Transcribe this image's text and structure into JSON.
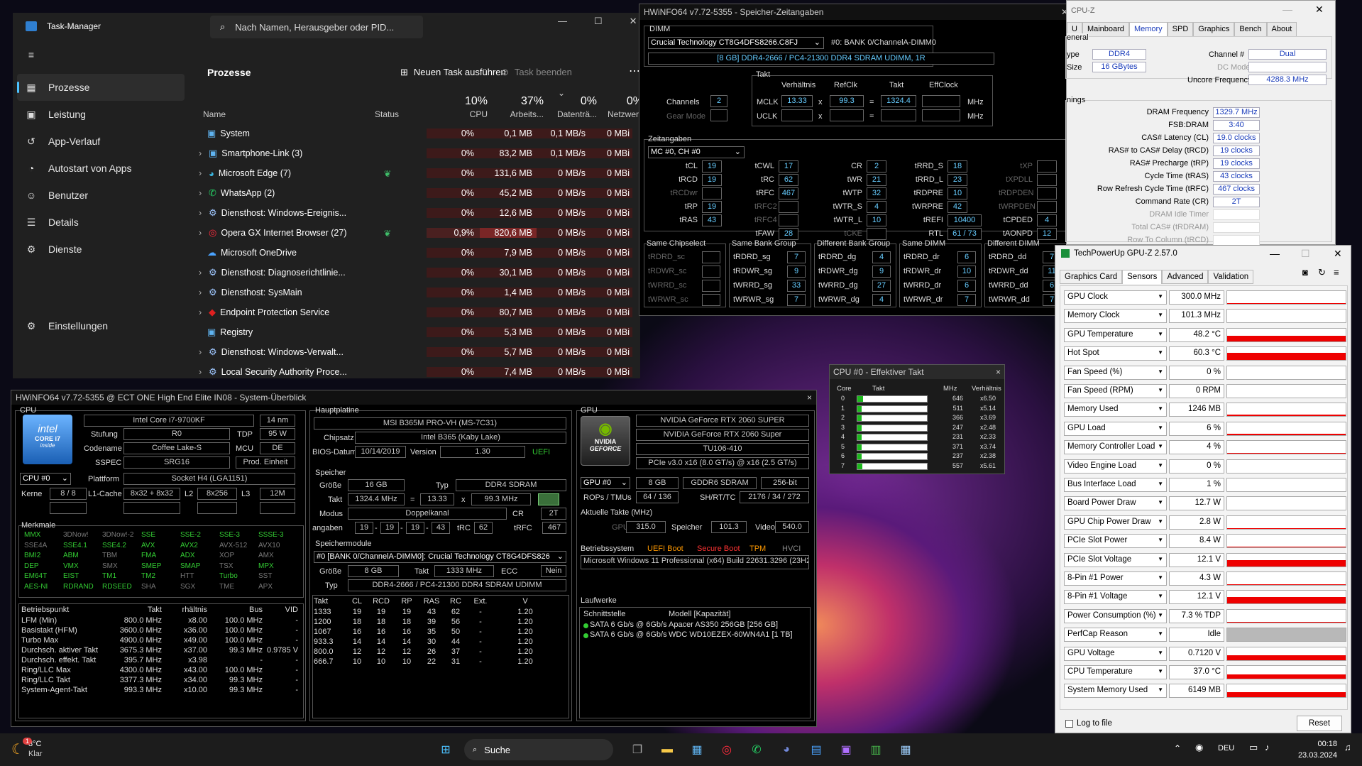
{
  "taskmanager": {
    "title": "Task-Manager",
    "search_placeholder": "Nach Namen, Herausgeber oder PID...",
    "nav": [
      {
        "label": "Prozesse",
        "icon": "grid-icon"
      },
      {
        "label": "Leistung",
        "icon": "chart-icon"
      },
      {
        "label": "App-Verlauf",
        "icon": "history-icon"
      },
      {
        "label": "Autostart von Apps",
        "icon": "speedometer-icon"
      },
      {
        "label": "Benutzer",
        "icon": "users-icon"
      },
      {
        "label": "Details",
        "icon": "list-icon"
      },
      {
        "label": "Dienste",
        "icon": "puzzle-icon"
      }
    ],
    "settings": "Einstellungen",
    "page_title": "Prozesse",
    "new_task": "Neuen Task ausführen",
    "end_task": "Task beenden",
    "col_name": "Name",
    "col_status": "Status",
    "cpu_pct": "10%",
    "cpu_lbl": "CPU",
    "mem_pct": "37%",
    "mem_lbl": "Arbeits...",
    "disk_pct": "0%",
    "disk_lbl": "Datenträ...",
    "net_pct": "0%",
    "net_lbl": "Netzwerk",
    "rows": [
      {
        "name": "System",
        "cpu": "0%",
        "mem": "0,1 MB",
        "disk": "0,1 MB/s",
        "net": "0 MBi"
      },
      {
        "name": "Smartphone-Link (3)",
        "cpu": "0%",
        "mem": "83,2 MB",
        "disk": "0,1 MB/s",
        "net": "0 MBi"
      },
      {
        "name": "Microsoft Edge (7)",
        "cpu": "0%",
        "mem": "131,6 MB",
        "disk": "0 MB/s",
        "net": "0 MBi"
      },
      {
        "name": "WhatsApp (2)",
        "cpu": "0%",
        "mem": "45,2 MB",
        "disk": "0 MB/s",
        "net": "0 MBi"
      },
      {
        "name": "Diensthost: Windows-Ereignis...",
        "cpu": "0%",
        "mem": "12,6 MB",
        "disk": "0 MB/s",
        "net": "0 MBi"
      },
      {
        "name": "Opera GX Internet Browser (27)",
        "cpu": "0,9%",
        "mem": "820,6 MB",
        "disk": "0 MB/s",
        "net": "0 MBi"
      },
      {
        "name": "Microsoft OneDrive",
        "cpu": "0%",
        "mem": "7,9 MB",
        "disk": "0 MB/s",
        "net": "0 MBi"
      },
      {
        "name": "Diensthost: Diagnoserichtlinie...",
        "cpu": "0%",
        "mem": "30,1 MB",
        "disk": "0 MB/s",
        "net": "0 MBi"
      },
      {
        "name": "Diensthost: SysMain",
        "cpu": "0%",
        "mem": "1,4 MB",
        "disk": "0 MB/s",
        "net": "0 MBi"
      },
      {
        "name": "Endpoint Protection Service",
        "cpu": "0%",
        "mem": "80,7 MB",
        "disk": "0 MB/s",
        "net": "0 MBi"
      },
      {
        "name": "Registry",
        "cpu": "0%",
        "mem": "5,3 MB",
        "disk": "0 MB/s",
        "net": "0 MBi"
      },
      {
        "name": "Diensthost: Windows-Verwalt...",
        "cpu": "0%",
        "mem": "5,7 MB",
        "disk": "0 MB/s",
        "net": "0 MBi"
      },
      {
        "name": "Local Security Authority Proce...",
        "cpu": "0%",
        "mem": "7,4 MB",
        "disk": "0 MB/s",
        "net": "0 MBi"
      }
    ]
  },
  "timings": {
    "title": "HWiNFO64 v7.72-5355 - Speicher-Zeitangaben",
    "dimm_lbl": "DIMM",
    "dimm_sel": "Crucial Technology CT8G4DFS8266.C8FJ",
    "dimm_slot": "#0: BANK 0/ChannelA-DIMM0",
    "dimm_info": "[8 GB] DDR4-2666 / PC4-21300 DDR4 SDRAM UDIMM, 1R",
    "takt_lbl": "Takt",
    "verh_lbl": "Verhältnis",
    "refclk_lbl": "RefClk",
    "takt2_lbl": "Takt",
    "effclk_lbl": "EffClock",
    "channels_lbl": "Channels",
    "channels": "2",
    "gearmode_lbl": "Gear Mode",
    "mclk_lbl": "MCLK",
    "mclk_ratio": "13.33",
    "mclk_ref": "99.3",
    "mclk_takt": "1324.4",
    "mhz": "MHz",
    "uclk_lbl": "UCLK",
    "zeit_lbl": "Zeitangaben",
    "mc_sel": "MC #0, CH #0",
    "t": {
      "tCL": "19",
      "tRCD": "19",
      "tRP": "19",
      "tRAS": "43",
      "tCWL": "17",
      "tRC": "62",
      "tRFC": "467",
      "tFAW": "28",
      "CR": "2",
      "tWR": "21",
      "tWTP": "32",
      "tWTR_S": "4",
      "tWTR_L": "10",
      "tRRD_S": "18",
      "tRRD_L": "23",
      "tRDPRE": "10",
      "tWRPRE": "42",
      "tREFI": "10400",
      "RTL": "61 / 73",
      "tCPDED": "4",
      "tAONPD": "12"
    },
    "lbls": {
      "tCL": "tCL",
      "tRCD": "tRCD",
      "tRCDwr": "tRCDwr",
      "tRP": "tRP",
      "tRAS": "tRAS",
      "tCWL": "tCWL",
      "tRC": "tRC",
      "tRFC": "tRFC",
      "tRFC2": "tRFC2",
      "tRFC4": "tRFC4",
      "tFAW": "tFAW",
      "CR": "CR",
      "tWR": "tWR",
      "tWTP": "tWTP",
      "tWTR_S": "tWTR_S",
      "tWTR_L": "tWTR_L",
      "tCKE": "tCKE",
      "tRRD_S": "tRRD_S",
      "tRRD_L": "tRRD_L",
      "tRDPRE": "tRDPRE",
      "tWRPRE": "tWRPRE",
      "tREFI": "tREFI",
      "RTL": "RTL",
      "tXP": "tXP",
      "tXPDLL": "tXPDLL",
      "tRDPDEN": "tRDPDEN",
      "tWRPDEN": "tWRPDEN",
      "tCPDED": "tCPDED",
      "tAONPD": "tAONPD"
    },
    "groups": [
      {
        "title": "Same Chipselect",
        "rows": [
          [
            "tRDRD_sc",
            ""
          ],
          [
            "tRDWR_sc",
            ""
          ],
          [
            "tWRRD_sc",
            ""
          ],
          [
            "tWRWR_sc",
            ""
          ]
        ]
      },
      {
        "title": "Same Bank Group",
        "rows": [
          [
            "tRDRD_sg",
            "7"
          ],
          [
            "tRDWR_sg",
            "9"
          ],
          [
            "tWRRD_sg",
            "33"
          ],
          [
            "tWRWR_sg",
            "7"
          ]
        ]
      },
      {
        "title": "Different Bank Group",
        "rows": [
          [
            "tRDRD_dg",
            "4"
          ],
          [
            "tRDWR_dg",
            "9"
          ],
          [
            "tWRRD_dg",
            "27"
          ],
          [
            "tWRWR_dg",
            "4"
          ]
        ]
      },
      {
        "title": "Same DIMM",
        "rows": [
          [
            "tRDRD_dr",
            "6"
          ],
          [
            "tRDWR_dr",
            "10"
          ],
          [
            "tWRRD_dr",
            "6"
          ],
          [
            "tWRWR_dr",
            "7"
          ]
        ]
      },
      {
        "title": "Different DIMM",
        "rows": [
          [
            "tRDRD_dd",
            "7"
          ],
          [
            "tRDWR_dd",
            "11"
          ],
          [
            "tWRRD_dd",
            "6"
          ],
          [
            "tWRWR_dd",
            "7"
          ]
        ]
      }
    ]
  },
  "efftakt": {
    "title": "CPU #0 - Effektiver Takt",
    "h_core": "Core",
    "h_takt": "Takt",
    "h_mhz": "MHz",
    "h_verh": "Verhältnis",
    "rows": [
      {
        "core": "0",
        "mhz": "646",
        "r": "x6.50",
        "fill": 0.08
      },
      {
        "core": "1",
        "mhz": "511",
        "r": "x5.14",
        "fill": 0.06
      },
      {
        "core": "2",
        "mhz": "366",
        "r": "x3.69",
        "fill": 0.05
      },
      {
        "core": "3",
        "mhz": "247",
        "r": "x2.48",
        "fill": 0.04
      },
      {
        "core": "4",
        "mhz": "231",
        "r": "x2.33",
        "fill": 0.04
      },
      {
        "core": "5",
        "mhz": "371",
        "r": "x3.74",
        "fill": 0.05
      },
      {
        "core": "6",
        "mhz": "237",
        "r": "x2.38",
        "fill": 0.04
      },
      {
        "core": "7",
        "mhz": "557",
        "r": "x5.61",
        "fill": 0.07
      }
    ]
  },
  "summary": {
    "title": "HWiNFO64 v7.72-5355 @ ECT  ONE High End Elite IN08 - System-Überblick",
    "cpu_lbl": "CPU",
    "cpu_name": "Intel Core i7-9700KF",
    "cpu_nm": "14 nm",
    "stufung_lbl": "Stufung",
    "stufung": "R0",
    "tdp_lbl": "TDP",
    "tdp": "95 W",
    "codename_lbl": "Codename",
    "codename": "Coffee Lake-S",
    "mcu_lbl": "MCU",
    "mcu": "DE",
    "sspec_lbl": "SSPEC",
    "sspec": "SRG16",
    "prod": "Prod. Einheit",
    "cpu_sel": "CPU #0",
    "plattform_lbl": "Plattform",
    "plattform": "Socket H4 (LGA1151)",
    "kerne_lbl": "Kerne",
    "kerne": "8 / 8",
    "l1_lbl": "L1-Cache",
    "l1": "8x32 + 8x32",
    "l2_lbl": "L2",
    "l2": "8x256",
    "l3_lbl": "L3",
    "l3": "12M",
    "merkmale_lbl": "Merkmale",
    "features": [
      [
        "MMX",
        "g"
      ],
      [
        "3DNow!",
        "d"
      ],
      [
        "3DNow!-2",
        "d"
      ],
      [
        "SSE",
        "g"
      ],
      [
        "SSE-2",
        "g"
      ],
      [
        "SSE-3",
        "g"
      ],
      [
        "SSSE-3",
        "g"
      ],
      [
        "SSE4A",
        "d"
      ],
      [
        "SSE4.1",
        "g"
      ],
      [
        "SSE4.2",
        "g"
      ],
      [
        "AVX",
        "g"
      ],
      [
        "AVX2",
        "g"
      ],
      [
        "AVX-512",
        "d"
      ],
      [
        "AVX10",
        "d"
      ],
      [
        "BMI2",
        "g"
      ],
      [
        "ABM",
        "g"
      ],
      [
        "TBM",
        "d"
      ],
      [
        "FMA",
        "g"
      ],
      [
        "ADX",
        "g"
      ],
      [
        "XOP",
        "d"
      ],
      [
        "AMX",
        "d"
      ],
      [
        "DEP",
        "g"
      ],
      [
        "VMX",
        "g"
      ],
      [
        "SMX",
        "d"
      ],
      [
        "SMEP",
        "g"
      ],
      [
        "SMAP",
        "g"
      ],
      [
        "TSX",
        "d"
      ],
      [
        "MPX",
        "g"
      ],
      [
        "EM64T",
        "g"
      ],
      [
        "EIST",
        "g"
      ],
      [
        "TM1",
        "g"
      ],
      [
        "TM2",
        "g"
      ],
      [
        "HTT",
        "d"
      ],
      [
        "Turbo",
        "g"
      ],
      [
        "SST",
        "d"
      ],
      [
        "AES-NI",
        "g"
      ],
      [
        "RDRAND",
        "g"
      ],
      [
        "RDSEED",
        "g"
      ],
      [
        "SHA",
        "d"
      ],
      [
        "SGX",
        "d"
      ],
      [
        "TME",
        "d"
      ],
      [
        "APX",
        "d"
      ]
    ],
    "bp_headers": [
      "Betriebspunkt",
      "Takt",
      "rhältnis",
      "Bus",
      "VID"
    ],
    "bp_rows": [
      [
        "LFM (Min)",
        "800.0 MHz",
        "x8.00",
        "100.0 MHz",
        "-"
      ],
      [
        "Basistakt (HFM)",
        "3600.0 MHz",
        "x36.00",
        "100.0 MHz",
        "-"
      ],
      [
        "Turbo Max",
        "4900.0 MHz",
        "x49.00",
        "100.0 MHz",
        "-"
      ],
      [
        "Durchsch. aktiver Takt",
        "3675.3 MHz",
        "x37.00",
        "99.3 MHz",
        "0.9785 V"
      ],
      [
        "Durchsch. effekt. Takt",
        "395.7 MHz",
        "x3.98",
        "-",
        "-"
      ],
      [
        "Ring/LLC Max",
        "4300.0 MHz",
        "x43.00",
        "100.0 MHz",
        "-"
      ],
      [
        "Ring/LLC Takt",
        "3377.3 MHz",
        "x34.00",
        "99.3 MHz",
        "-"
      ],
      [
        "System-Agent-Takt",
        "993.3 MHz",
        "x10.00",
        "99.3 MHz",
        "-"
      ]
    ],
    "hp_lbl": "Hauptplatine",
    "mb": "MSI B365M PRO-VH (MS-7C31)",
    "chipsatz_lbl": "Chipsatz",
    "chipsatz": "Intel B365 (Kaby Lake)",
    "bios_lbl": "BIOS-Datum",
    "bios_date": "10/14/2019",
    "version_lbl": "Version",
    "version": "1.30",
    "uefi": "UEFI",
    "sp_lbl": "Speicher",
    "groesse_lbl": "Größe",
    "groesse": "16 GB",
    "typ_lbl": "Typ",
    "typ": "DDR4 SDRAM",
    "takt_lbl": "Takt",
    "takt": "1324.4 MHz",
    "eq": "=",
    "ratio": "13.33",
    "x": "x",
    "bus": "99.3 MHz",
    "modus_lbl": "Modus",
    "modus": "Doppelkanal",
    "cr_lbl": "CR",
    "cr": "2T",
    "zeit_lbl": "angaben",
    "z": [
      "19",
      "19",
      "19",
      "43"
    ],
    "trc_lbl": "tRC",
    "trc": "62",
    "trfc_lbl": "tRFC",
    "trfc": "467",
    "spm_lbl": "Speichermodule",
    "spm_sel": "#0 [BANK 0/ChannelA-DIMM0]: Crucial Technology CT8G4DFS826",
    "spm_size": "8 GB",
    "spm_takt_lbl": "Takt",
    "spm_takt": "1333 MHz",
    "ecc_lbl": "ECC",
    "ecc": "Nein",
    "spm_typ": "DDR4-2666 / PC4-21300 DDR4 SDRAM UDIMM",
    "spm_headers": [
      "Takt",
      "CL",
      "RCD",
      "RP",
      "RAS",
      "RC",
      "Ext.",
      "V"
    ],
    "spm_rows": [
      [
        "1333",
        "19",
        "19",
        "19",
        "43",
        "62",
        "-",
        "1.20"
      ],
      [
        "1200",
        "18",
        "18",
        "18",
        "39",
        "56",
        "-",
        "1.20"
      ],
      [
        "1067",
        "16",
        "16",
        "16",
        "35",
        "50",
        "-",
        "1.20"
      ],
      [
        "933.3",
        "14",
        "14",
        "14",
        "30",
        "44",
        "-",
        "1.20"
      ],
      [
        "800.0",
        "12",
        "12",
        "12",
        "26",
        "37",
        "-",
        "1.20"
      ],
      [
        "666.7",
        "10",
        "10",
        "10",
        "22",
        "31",
        "-",
        "1.20"
      ]
    ],
    "gpu_lbl": "GPU",
    "gpu1": "NVIDIA GeForce RTX 2060 SUPER",
    "gpu2": "NVIDIA GeForce RTX 2060 Super",
    "gpu3": "TU106-410",
    "gpu4": "PCIe v3.0 x16 (8.0 GT/s) @ x16 (2.5 GT/s)",
    "gpu_sel": "GPU #0",
    "vram": "8 GB",
    "vtype": "GDDR6 SDRAM",
    "vbit": "256-bit",
    "rops_lbl": "ROPs / TMUs",
    "rops": "64 / 136",
    "sh_lbl": "SH/RT/TC",
    "sh": "2176 / 34 / 272",
    "akt_lbl": "Aktuelle Takte (MHz)",
    "gpu_clk_lbl": "GPU",
    "gpu_clk": "315.0",
    "mem_clk_lbl": "Speicher",
    "mem_clk": "101.3",
    "vid_clk_lbl": "Video",
    "vid_clk": "540.0",
    "os_lbl": "Betriebssystem",
    "uefi_boot": "UEFI Boot",
    "secure_boot": "Secure Boot",
    "tpm": "TPM",
    "hvci": "HVCI",
    "os": "Microsoft Windows 11 Professional (x64) Build 22631.3296 (23H2)",
    "lw_lbl": "Laufwerke",
    "lw_headers": [
      "Schnittstelle",
      "Modell [Kapazität]"
    ],
    "lw_rows": [
      [
        "SATA 6 Gb/s @ 6Gb/s",
        "Apacer AS350 256GB [256 GB]"
      ],
      [
        "SATA 6 Gb/s @ 6Gb/s",
        "WDC WD10EZEX-60WN4A1 [1 TB]"
      ]
    ],
    "intel_logo": "intel",
    "intel_core": "CORE i7",
    "intel_inside": "inside",
    "nvidia_logo": "NVIDIA",
    "geforce": "GEFORCE"
  },
  "cpuz": {
    "title": "CPU-Z",
    "tabs": [
      "U",
      "Mainboard",
      "Memory",
      "SPD",
      "Graphics",
      "Bench",
      "About"
    ],
    "general": "eneral",
    "type_lbl": "ype",
    "type": "DDR4",
    "size_lbl": "Size",
    "size": "16 GBytes",
    "channel_lbl": "Channel #",
    "channel": "Dual",
    "dc_lbl": "DC Mode",
    "uncore_lbl": "Uncore Frequency",
    "uncore": "4288.3 MHz",
    "timings": "nings",
    "rows": [
      [
        "DRAM Frequency",
        "1329.7 MHz"
      ],
      [
        "FSB:DRAM",
        "3:40"
      ],
      [
        "CAS# Latency (CL)",
        "19.0 clocks"
      ],
      [
        "RAS# to CAS# Delay (tRCD)",
        "19 clocks"
      ],
      [
        "RAS# Precharge (tRP)",
        "19 clocks"
      ],
      [
        "Cycle Time (tRAS)",
        "43 clocks"
      ],
      [
        "Row Refresh Cycle Time (tRFC)",
        "467 clocks"
      ],
      [
        "Command Rate (CR)",
        "2T"
      ]
    ],
    "dim_rows": [
      "DRAM Idle Timer",
      "Total CAS# (tRDRAM)",
      "Row To Column (tRCD)"
    ]
  },
  "gpuz": {
    "title": "TechPowerUp GPU-Z 2.57.0",
    "tabs": [
      "Graphics Card",
      "Sensors",
      "Advanced",
      "Validation"
    ],
    "sensors": [
      {
        "name": "GPU Clock",
        "value": "300.0 MHz",
        "level": 0.05
      },
      {
        "name": "Memory Clock",
        "value": "101.3 MHz",
        "level": 0.02
      },
      {
        "name": "GPU Temperature",
        "value": "48.2 °C",
        "level": 0.45
      },
      {
        "name": "Hot Spot",
        "value": "60.3 °C",
        "level": 0.55
      },
      {
        "name": "Fan Speed (%)",
        "value": "0 %",
        "level": 0
      },
      {
        "name": "Fan Speed (RPM)",
        "value": "0 RPM",
        "level": 0
      },
      {
        "name": "Memory Used",
        "value": "1246 MB",
        "level": 0.15
      },
      {
        "name": "GPU Load",
        "value": "6 %",
        "level": 0.08
      },
      {
        "name": "Memory Controller Load",
        "value": "4 %",
        "level": 0.05
      },
      {
        "name": "Video Engine Load",
        "value": "0 %",
        "level": 0
      },
      {
        "name": "Bus Interface Load",
        "value": "1 %",
        "level": 0.02
      },
      {
        "name": "Board Power Draw",
        "value": "12.7 W",
        "level": 0.05
      },
      {
        "name": "GPU Chip Power Draw",
        "value": "2.8 W",
        "level": 0.03
      },
      {
        "name": "PCIe Slot Power",
        "value": "8.4 W",
        "level": 0.05
      },
      {
        "name": "PCIe Slot Voltage",
        "value": "12.1 V",
        "level": 0.5
      },
      {
        "name": "8-Pin #1 Power",
        "value": "4.3 W",
        "level": 0.04
      },
      {
        "name": "8-Pin #1 Voltage",
        "value": "12.1 V",
        "level": 0.5
      },
      {
        "name": "Power Consumption (%)",
        "value": "7.3 % TDP",
        "level": 0.06
      },
      {
        "name": "PerfCap Reason",
        "value": "Idle",
        "level": 1,
        "gray": true
      },
      {
        "name": "GPU Voltage",
        "value": "0.7120 V",
        "level": 0.35
      },
      {
        "name": "CPU Temperature",
        "value": "37.0 °C",
        "level": 0.35
      },
      {
        "name": "System Memory Used",
        "value": "6149 MB",
        "level": 0.4
      }
    ],
    "log": "Log to file",
    "reset": "Reset"
  },
  "taskbar": {
    "weather_temp": "8°C",
    "weather_desc": "Klar",
    "weather_badge": "1",
    "search": "Suche",
    "lang": "DEU",
    "time": "00:18",
    "date": "23.03.2024"
  }
}
